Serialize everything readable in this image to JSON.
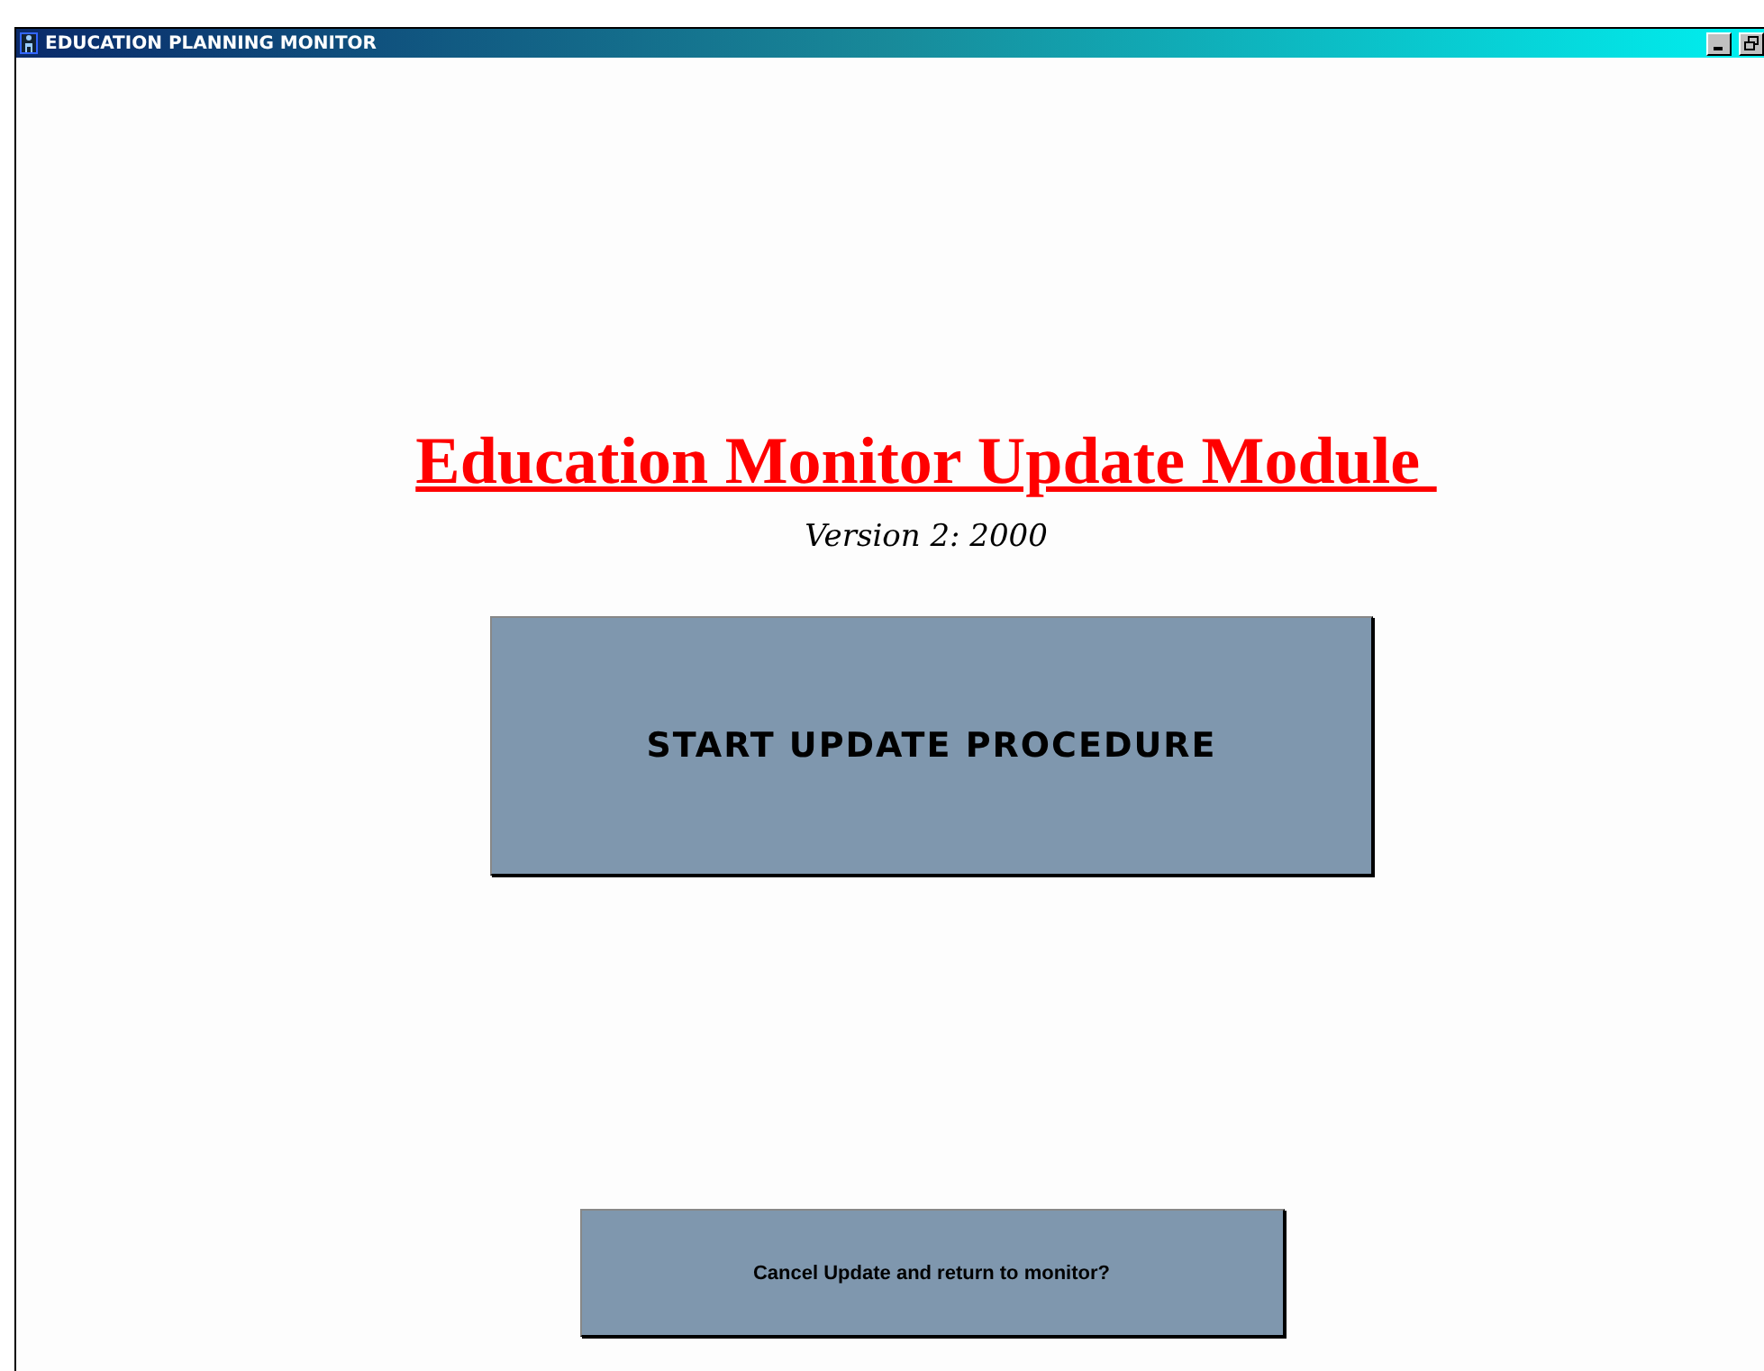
{
  "window": {
    "title": "EDUCATION PLANNING MONITOR"
  },
  "heading": "Education Monitor Update Module ",
  "version": "Version 2: 2000",
  "buttons": [
    {
      "label": "START UPDATE PROCEDURE",
      "kind": "primary"
    },
    {
      "label": "Cancel Update and return to monitor?",
      "kind": "secondary"
    }
  ]
}
